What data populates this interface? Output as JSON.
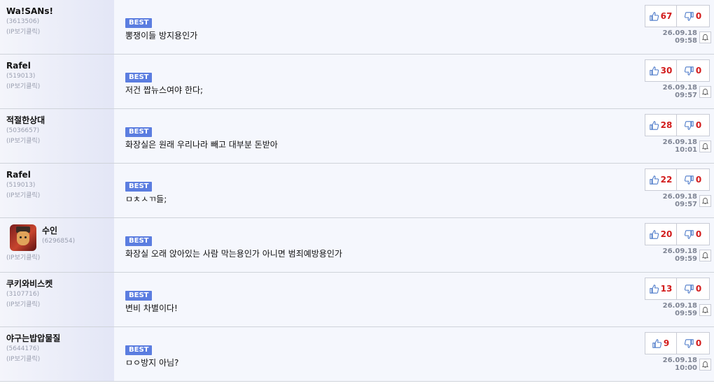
{
  "colors": {
    "best_bg": "#5b7de0",
    "vote_count": "#d21c1c",
    "thumb_blue": "#4a78c8"
  },
  "comments": [
    {
      "nick": "Wa!SANs!",
      "uid": "(3613506)",
      "ip": "(IP보기클릭)",
      "best": "BEST",
      "text": "뽕쟁이들 방지용인가",
      "up": "67",
      "down": "0",
      "time": "26.09.18 09:58"
    },
    {
      "nick": "Rafel",
      "uid": "(519013)",
      "ip": "(IP보기클릭)",
      "best": "BEST",
      "text": "저건 짭뉴스여야 한다;",
      "up": "30",
      "down": "0",
      "time": "26.09.18 09:57"
    },
    {
      "nick": "적절한상대",
      "uid": "(5036657)",
      "ip": "(IP보기클릭)",
      "best": "BEST",
      "text": "화장실은 원래 우리나라 빼고 대부분 돈받아",
      "up": "28",
      "down": "0",
      "time": "26.09.18 10:01"
    },
    {
      "nick": "Rafel",
      "uid": "(519013)",
      "ip": "(IP보기클릭)",
      "best": "BEST",
      "text": "ㅁㅊㅅㄲ들;",
      "up": "22",
      "down": "0",
      "time": "26.09.18 09:57"
    },
    {
      "nick": "수인",
      "uid": "(6296854)",
      "ip": "(IP보기클릭)",
      "best": "BEST",
      "text": "화장실 오래 앉아있는 사람 막는용인가 아니면 범죄예방용인가",
      "up": "20",
      "down": "0",
      "time": "26.09.18 09:59",
      "avatar": "user-avatar"
    },
    {
      "nick": "쿠키와비스켓",
      "uid": "(3107716)",
      "ip": "(IP보기클릭)",
      "best": "BEST",
      "text": "변비 차별이다!",
      "up": "13",
      "down": "0",
      "time": "26.09.18 09:59"
    },
    {
      "nick": "야구는밥압물질",
      "uid": "(5644176)",
      "ip": "(IP보기클릭)",
      "best": "BEST",
      "text": "ㅁㅇ방지 아님?",
      "up": "9",
      "down": "0",
      "time": "26.09.18 10:00"
    }
  ]
}
